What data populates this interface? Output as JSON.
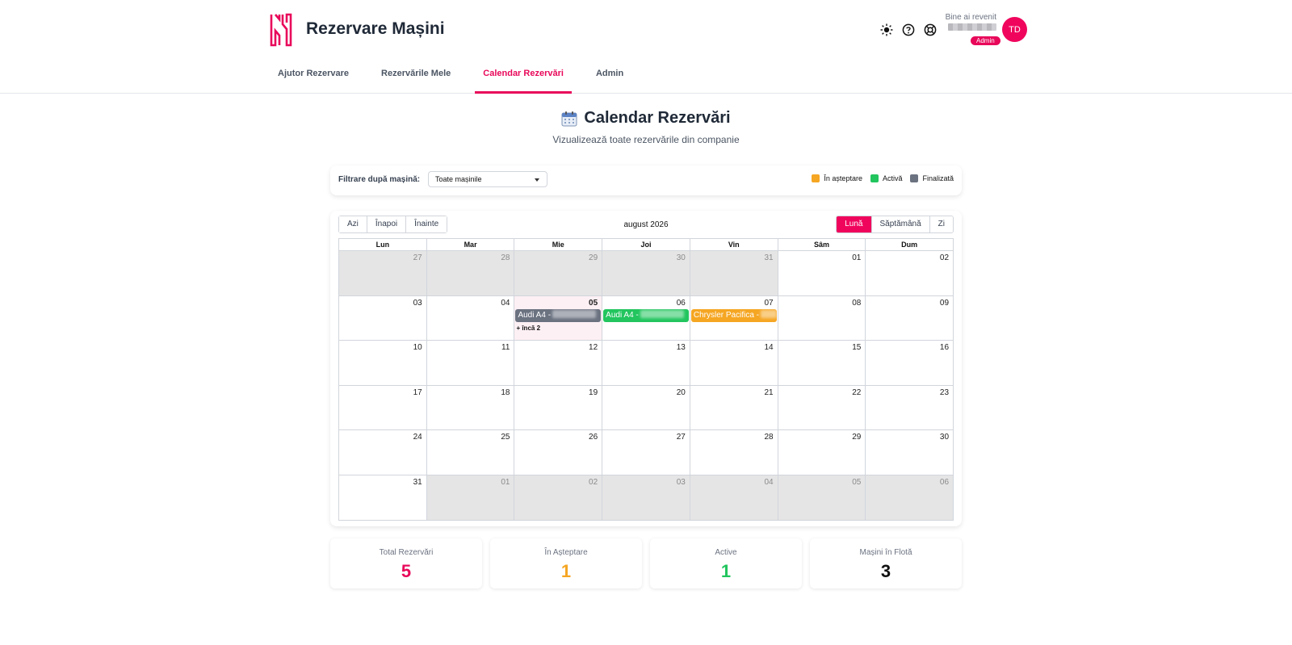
{
  "app": {
    "title": "Rezervare Mașini"
  },
  "header": {
    "welcome": "Bine ai revenit",
    "role": "Admin",
    "avatar_initials": "TD"
  },
  "tabs": [
    {
      "label": "Ajutor Rezervare"
    },
    {
      "label": "Rezervările Mele"
    },
    {
      "label": "Calendar Rezervări",
      "active": true
    },
    {
      "label": "Admin"
    }
  ],
  "page": {
    "title": "Calendar Rezervări",
    "subtitle": "Vizualizează toate rezervările din companie"
  },
  "filter": {
    "label": "Filtrare după mașină:",
    "selected": "Toate mașinile"
  },
  "legend": [
    {
      "label": "În așteptare",
      "color": "#f5a623"
    },
    {
      "label": "Activă",
      "color": "#22c55e"
    },
    {
      "label": "Finalizată",
      "color": "#6b7280"
    }
  ],
  "calendar": {
    "nav": {
      "today": "Azi",
      "back": "Înapoi",
      "next": "Înainte"
    },
    "month_label": "august 2026",
    "views": {
      "month": "Lună",
      "week": "Săptămână",
      "day": "Zi"
    },
    "weekdays": [
      "Lun",
      "Mar",
      "Mie",
      "Joi",
      "Vin",
      "Sâm",
      "Dum"
    ],
    "weeks": [
      [
        "27",
        "28",
        "29",
        "30",
        "31",
        "01",
        "02"
      ],
      [
        "03",
        "04",
        "05",
        "06",
        "07",
        "08",
        "09"
      ],
      [
        "10",
        "11",
        "12",
        "13",
        "14",
        "15",
        "16"
      ],
      [
        "17",
        "18",
        "19",
        "20",
        "21",
        "22",
        "23"
      ],
      [
        "24",
        "25",
        "26",
        "27",
        "28",
        "29",
        "30"
      ],
      [
        "31",
        "01",
        "02",
        "03",
        "04",
        "05",
        "06"
      ]
    ],
    "events": {
      "wed": {
        "label": "Audi A4 -",
        "color": "#6b7280"
      },
      "thu": {
        "label": "Audi A4 -",
        "color": "#22c55e"
      },
      "fri": {
        "label": "Chrysler Pacifica -",
        "color": "#f5a623"
      }
    },
    "more_label": "+ încă 2"
  },
  "stats": [
    {
      "label": "Total Rezervări",
      "value": "5",
      "color": "#e8085a"
    },
    {
      "label": "În Așteptare",
      "value": "1",
      "color": "#f5a623"
    },
    {
      "label": "Active",
      "value": "1",
      "color": "#22c55e"
    },
    {
      "label": "Mașini în Flotă",
      "value": "3",
      "color": "#111111"
    }
  ]
}
